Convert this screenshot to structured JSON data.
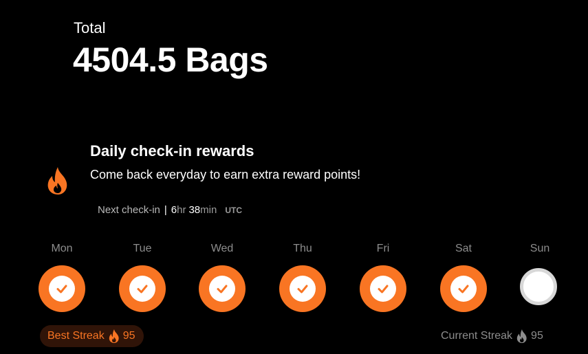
{
  "summary": {
    "total_label": "Total",
    "total_value": "4504.5 Bags"
  },
  "checkin": {
    "title": "Daily check-in rewards",
    "subtitle": "Come back everyday to earn extra reward points!",
    "next_label": "Next check-in",
    "separator": "|",
    "hours": "6",
    "hours_unit": "hr",
    "minutes": "38",
    "minutes_unit": "min",
    "timezone": "UTC"
  },
  "days": [
    {
      "label": "Mon",
      "checked": true
    },
    {
      "label": "Tue",
      "checked": true
    },
    {
      "label": "Wed",
      "checked": true
    },
    {
      "label": "Thu",
      "checked": true
    },
    {
      "label": "Fri",
      "checked": true
    },
    {
      "label": "Sat",
      "checked": true
    },
    {
      "label": "Sun",
      "checked": false
    }
  ],
  "streaks": {
    "best_label": "Best Streak",
    "best_value": "95",
    "current_label": "Current Streak",
    "current_value": "95"
  },
  "icons": {
    "main": "flame-icon",
    "checked": "check-icon",
    "best": "flame-icon",
    "current": "flame-icon"
  },
  "colors": {
    "accent": "#f97523",
    "background": "#000000",
    "muted": "#8d8d8d",
    "best_streak_bg": "#301408"
  }
}
